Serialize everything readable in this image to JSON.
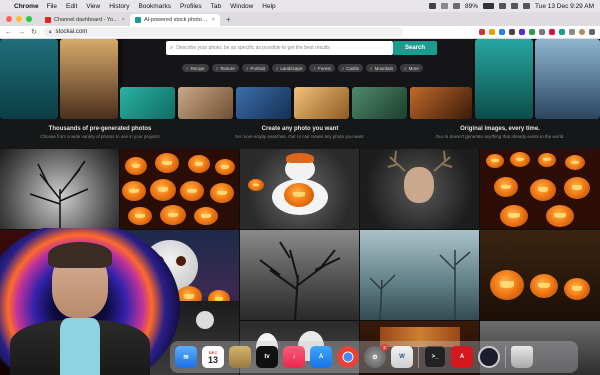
{
  "menubar": {
    "app_name": "Chrome",
    "items": [
      "File",
      "Edit",
      "View",
      "History",
      "Bookmarks",
      "Profiles",
      "Tab",
      "Window",
      "Help"
    ],
    "battery": "89%",
    "clock": "Tue 13 Dec 9:29 AM"
  },
  "tabs": [
    {
      "label": "Channel dashboard - YouTube",
      "favicon_color": "#e62117",
      "active": false
    },
    {
      "label": "AI-powered stock photos | Sto...",
      "favicon_color": "#1a9d8f",
      "active": true
    }
  ],
  "address_bar": {
    "url": "stockai.com"
  },
  "search": {
    "placeholder": "Describe your photo, be as specific as possible to get the best results",
    "button_label": "Search",
    "chips": [
      "Recipe",
      "Texture",
      "Portrait",
      "Landscape",
      "Forest",
      "Castle",
      "Mountain",
      "More"
    ]
  },
  "features": [
    {
      "title": "Thousands of pre-generated photos",
      "subtitle": "Choose from a wide variety of photos to use in your projects"
    },
    {
      "title": "Create any photo you want",
      "subtitle": "No more empty searches. Our AI can create any photo you want."
    },
    {
      "title": "Original images, every time.",
      "subtitle": "Our AI doesn't generate anything that already exists in the world."
    }
  ],
  "dock": {
    "calendar_month": "DEC",
    "calendar_day": "13",
    "tv_label": "tv",
    "settings_badge": "2",
    "icons": [
      "mail-icon",
      "calendar-icon",
      "notes-icon",
      "apple-tv-icon",
      "music-icon",
      "app-store-icon",
      "chrome-icon",
      "system-settings-icon",
      "word-icon",
      "terminal-icon",
      "acrobat-icon",
      "obs-icon",
      "trash-icon"
    ]
  },
  "colors": {
    "accent": "#1a9d8f",
    "page_bg": "#0e0f10",
    "pumpkin_orange": "#f07a16"
  }
}
